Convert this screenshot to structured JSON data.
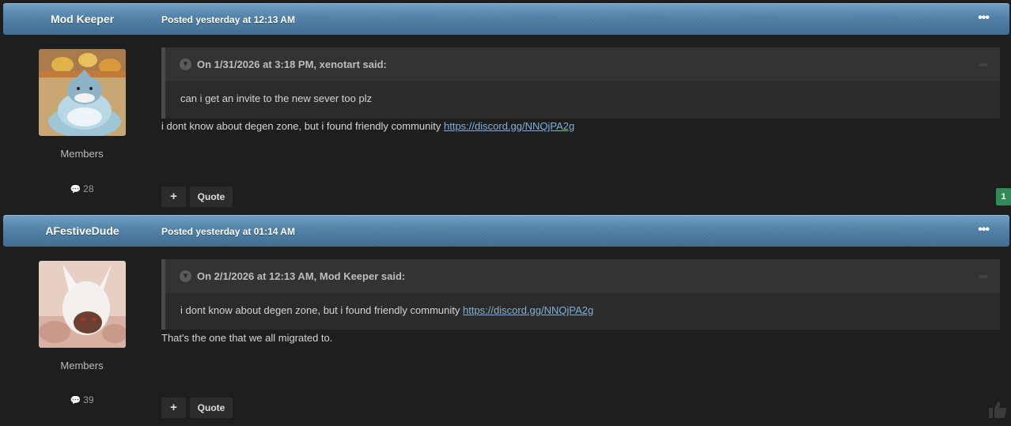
{
  "posts": [
    {
      "author": "Mod Keeper",
      "posted": "Posted yesterday at 12:13 AM",
      "menu_icon": "•••",
      "group": "Members",
      "post_count": "28",
      "quote": {
        "citation": "On 1/31/2026 at 3:18 PM, xenotart said:",
        "text": "can i get an invite to the new sever too plz"
      },
      "body_text": "i dont know about degen zone, but i found friendly community ",
      "body_link": "https://discord.gg/NNQjPA2g",
      "plus_label": "+",
      "quote_label": "Quote",
      "reputation": "1"
    },
    {
      "author": "AFestiveDude",
      "posted": "Posted yesterday at 01:14 AM",
      "menu_icon": "•••",
      "group": "Members",
      "post_count": "39",
      "quote": {
        "citation": "On 2/1/2026 at 12:13 AM, Mod Keeper said:",
        "text": "i dont know about degen zone, but i found friendly community ",
        "link": "https://discord.gg/NNQjPA2g"
      },
      "body_text": "That's the one that we all migrated to.",
      "plus_label": "+",
      "quote_label": "Quote"
    }
  ],
  "colors": {
    "header_blue": "#4f7fa6",
    "link": "#7fb0dd",
    "reputation_green": "#2e8b57",
    "background": "#1e1e1e"
  }
}
